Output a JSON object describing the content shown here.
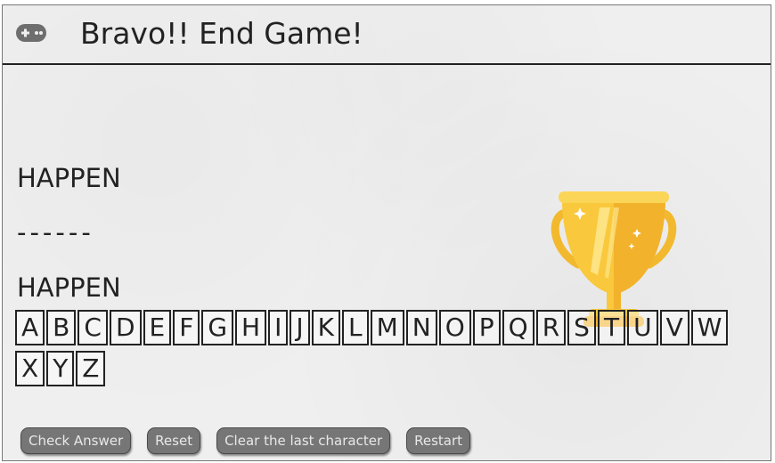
{
  "header": {
    "icon": "gamepad-icon",
    "title": "Bravo!! End Game!"
  },
  "game": {
    "target_word": "HAPPEN",
    "masked_word": "------",
    "answer": "HAPPEN",
    "trophy_icon": "trophy-icon"
  },
  "keyboard": {
    "letters": [
      "A",
      "B",
      "C",
      "D",
      "E",
      "F",
      "G",
      "H",
      "I",
      "J",
      "K",
      "L",
      "M",
      "N",
      "O",
      "P",
      "Q",
      "R",
      "S",
      "T",
      "U",
      "V",
      "W",
      "X",
      "Y",
      "Z"
    ]
  },
  "controls": {
    "check_answer": "Check Answer",
    "reset": "Reset",
    "clear_last": "Clear the last character",
    "restart": "Restart"
  },
  "colors": {
    "trophy_gold": "#F9C83C",
    "button_bg": "#767676",
    "background": "#EFEFEF"
  }
}
